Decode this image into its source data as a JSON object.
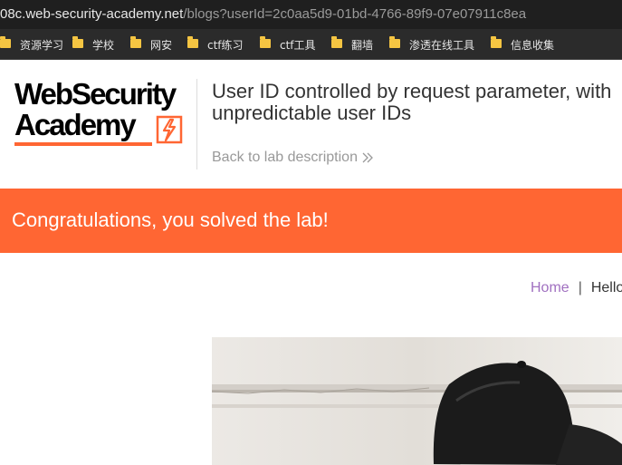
{
  "browser": {
    "url_host": "08c.web-security-academy.net",
    "url_path": "/blogs?userId=2c0aa5d9-01bd-4766-89f9-07e07911c8ea"
  },
  "bookmarks": [
    {
      "label": "资源学习",
      "icon": "folder-icon"
    },
    {
      "label": "学校",
      "icon": "folder-icon"
    },
    {
      "label": "网安",
      "icon": "folder-icon"
    },
    {
      "label": "ctf练习",
      "icon": "folder-icon"
    },
    {
      "label": "ctf工具",
      "icon": "folder-icon"
    },
    {
      "label": "翻墙",
      "icon": "folder-icon"
    },
    {
      "label": "渗透在线工具",
      "icon": "folder-icon"
    },
    {
      "label": "信息收集",
      "icon": "folder-icon"
    }
  ],
  "header": {
    "logo_line1": "WebSecurity",
    "logo_line2": "Academy",
    "title": "User ID controlled by request parameter, with unpredictable user IDs",
    "back_link": "Back to lab description",
    "back_icon": "double-chevron-right-icon"
  },
  "banner": {
    "text": "Congratulations, you solved the lab!",
    "color": "#ff6633"
  },
  "nav": {
    "home": "Home",
    "separator": "|",
    "hello": "Hello"
  },
  "colors": {
    "accent": "#ff6633",
    "link": "#a070c0"
  }
}
